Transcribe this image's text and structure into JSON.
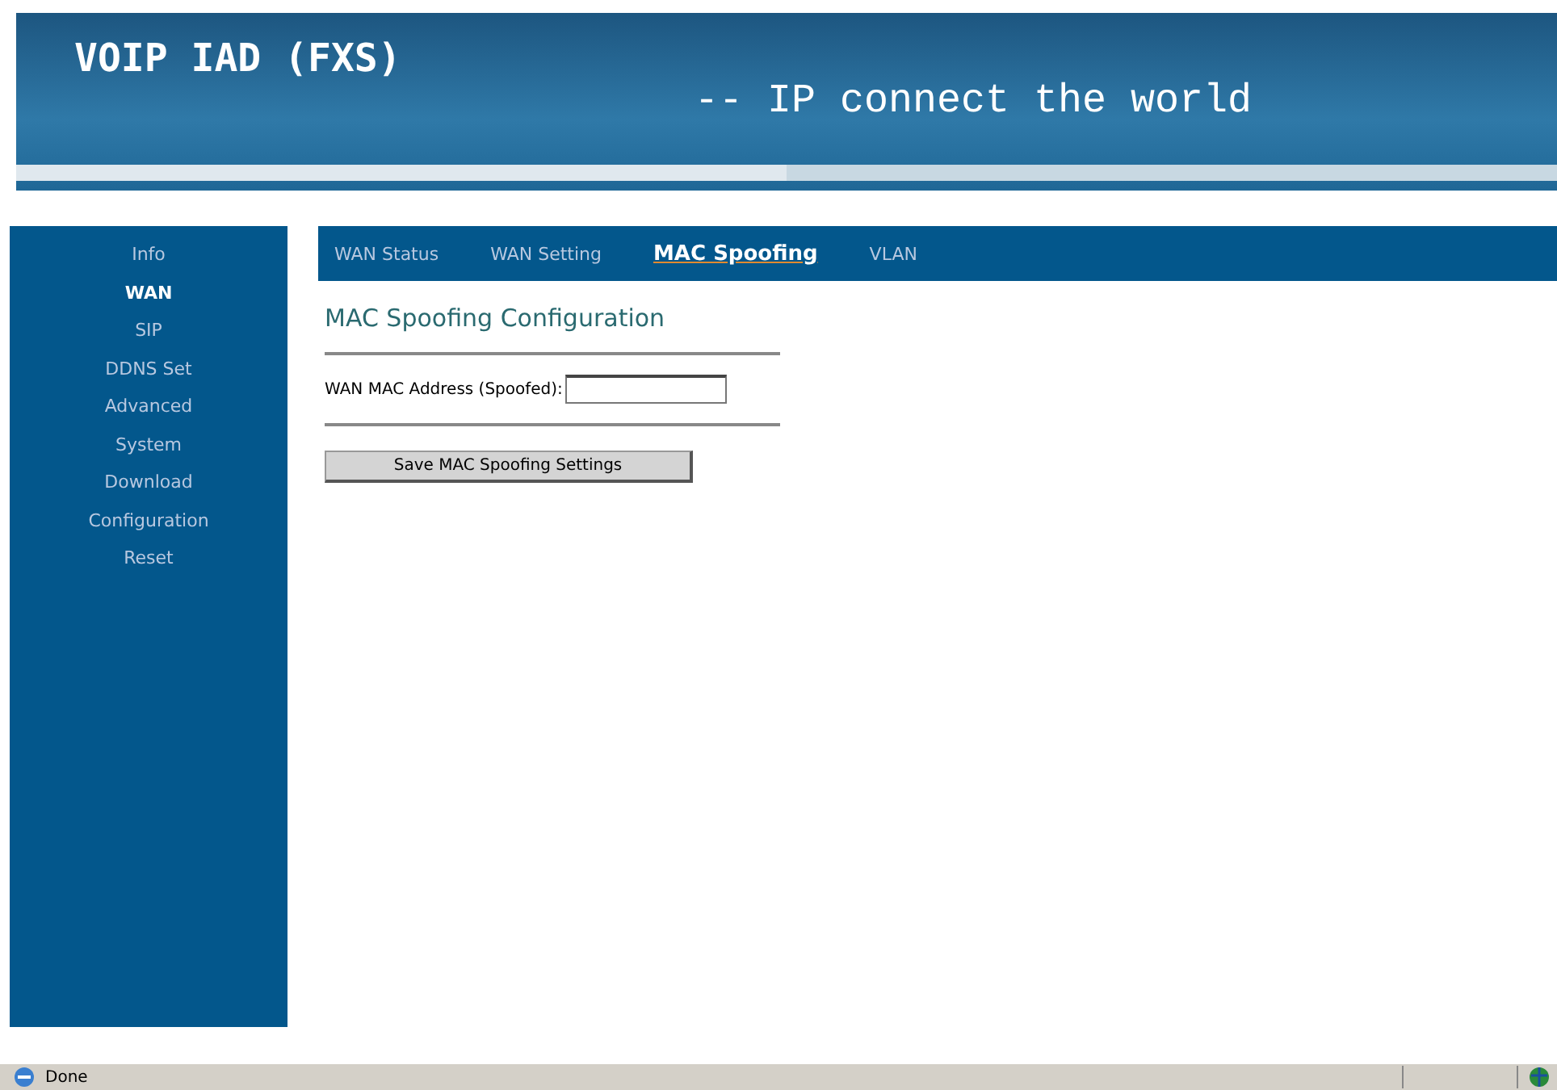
{
  "header": {
    "title": "VOIP IAD (FXS)",
    "slogan": "--  IP connect the world"
  },
  "sidebar": {
    "items": [
      {
        "label": "Info",
        "selected": false
      },
      {
        "label": "WAN",
        "selected": true
      },
      {
        "label": "SIP",
        "selected": false
      },
      {
        "label": "DDNS Set",
        "selected": false
      },
      {
        "label": "Advanced",
        "selected": false
      },
      {
        "label": "System",
        "selected": false
      },
      {
        "label": "Download",
        "selected": false
      },
      {
        "label": "Configuration",
        "selected": false
      },
      {
        "label": "Reset",
        "selected": false
      }
    ]
  },
  "tabs": [
    {
      "label": "WAN Status",
      "selected": false
    },
    {
      "label": "WAN Setting",
      "selected": false
    },
    {
      "label": "MAC Spoofing",
      "selected": true
    },
    {
      "label": "VLAN",
      "selected": false
    }
  ],
  "section_title": "MAC Spoofing Configuration",
  "field": {
    "label": "WAN MAC Address (Spoofed):"
  },
  "save_button": "Save MAC Spoofing Settings",
  "status_bar": {
    "text": "Done"
  }
}
